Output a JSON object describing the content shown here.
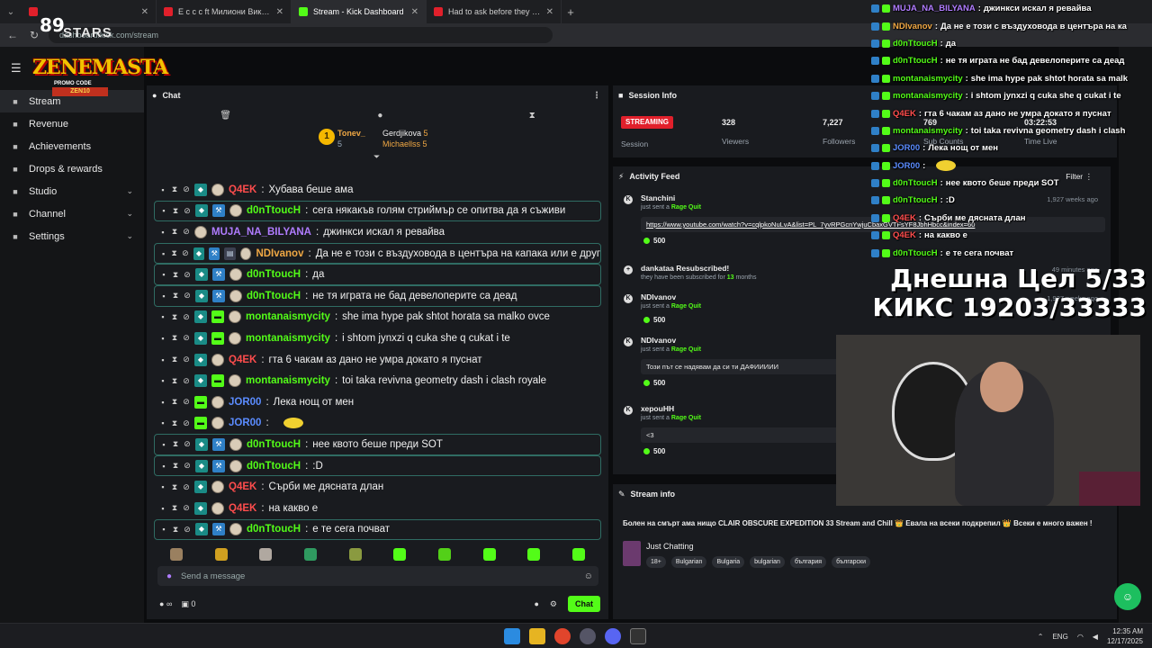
{
  "browser": {
    "tabs": [
      {
        "title": "",
        "color": "#e1202b",
        "active": false
      },
      {
        "title": "Е с с с ft Милиони Викай ги - YouTube",
        "color": "#e1202b",
        "active": false
      },
      {
        "title": "Stream - Kick Dashboard",
        "color": "#53fc18",
        "active": true
      },
      {
        "title": "Had to ask before they started",
        "color": "#e1202b",
        "active": false
      }
    ],
    "url": "dashboard.kick.com/stream"
  },
  "overlay_logo": {
    "stars_number": "89",
    "stars_label": "STARS",
    "brand": "ZENEMASTA",
    "promo": "PROMO CODE",
    "promo_code": "ZEN10"
  },
  "sidebar": {
    "items": [
      {
        "label": "Stream",
        "icon": "broadcast-icon",
        "active": true,
        "chevron": false
      },
      {
        "label": "Revenue",
        "icon": "wallet-icon",
        "active": false,
        "chevron": false
      },
      {
        "label": "Achievements",
        "icon": "trophy-icon",
        "active": false,
        "chevron": false
      },
      {
        "label": "Drops & rewards",
        "icon": "gift-icon",
        "active": false,
        "chevron": false
      },
      {
        "label": "Studio",
        "icon": "studio-icon",
        "active": false,
        "chevron": true
      },
      {
        "label": "Channel",
        "icon": "user-icon",
        "active": false,
        "chevron": true
      },
      {
        "label": "Settings",
        "icon": "gear-icon",
        "active": false,
        "chevron": true
      }
    ]
  },
  "chat": {
    "title": "Chat",
    "pinned": {
      "rank": "1",
      "user1": "Tonev_",
      "user1_count": "5",
      "user2": "Gerdjikova",
      "user2_count": "5",
      "user3": "Michaellss",
      "user3_count": "5"
    },
    "messages": [
      {
        "user": "Q4EK",
        "color": "#ff4d4d",
        "text": "Хубава беше ама",
        "badges": [
          "sub"
        ],
        "hl": false
      },
      {
        "user": "d0nTtoucH",
        "color": "#53fc18",
        "text": "сега някакъв голям стриймър се опитва да я съживи",
        "badges": [
          "sub",
          "vip"
        ],
        "hl": true
      },
      {
        "user": "MUJA_NA_BILYANA",
        "color": "#b07cff",
        "text": "джинкси искал я ревайва",
        "badges": [],
        "hl": false
      },
      {
        "user": "NDIvanov",
        "color": "#f0a844",
        "text": "Да не е този с въздуховода в центъра на капака или е друг",
        "badges": [
          "sub",
          "vip",
          "gift"
        ],
        "hl": true
      },
      {
        "user": "d0nTtoucH",
        "color": "#53fc18",
        "text": "да",
        "badges": [
          "sub",
          "vip"
        ],
        "hl": true
      },
      {
        "user": "d0nTtoucH",
        "color": "#53fc18",
        "text": "не тя играта не бад девелоперите са деад",
        "badges": [
          "sub",
          "vip"
        ],
        "hl": true
      },
      {
        "user": "montanaismycity",
        "color": "#53fc18",
        "text": "she ima hype pak shtot horata sa malko ovce",
        "badges": [
          "sub",
          "og"
        ],
        "hl": false
      },
      {
        "user": "montanaismycity",
        "color": "#53fc18",
        "text": "i shtom jynxzi q cuka she q cukat i te",
        "badges": [
          "sub",
          "og"
        ],
        "hl": false
      },
      {
        "user": "Q4EK",
        "color": "#ff4d4d",
        "text": "гта 6 чакам аз дано не умра докато я пуснат",
        "badges": [
          "sub"
        ],
        "hl": false
      },
      {
        "user": "montanaismycity",
        "color": "#53fc18",
        "text": "toi taka revivna geometry dash i clash royale",
        "badges": [
          "sub",
          "og"
        ],
        "hl": false
      },
      {
        "user": "JOR00",
        "color": "#5b8cff",
        "text": "Лека нощ от мен",
        "badges": [
          "og"
        ],
        "hl": false
      },
      {
        "user": "JOR00",
        "color": "#5b8cff",
        "text": "",
        "badges": [
          "og"
        ],
        "hl": false,
        "sticker": true
      },
      {
        "user": "d0nTtoucH",
        "color": "#53fc18",
        "text": "нее квото беше преди SOT",
        "badges": [
          "sub",
          "vip"
        ],
        "hl": true
      },
      {
        "user": "d0nTtoucH",
        "color": "#53fc18",
        "text": ":D",
        "badges": [
          "sub",
          "vip"
        ],
        "hl": true
      },
      {
        "user": "Q4EK",
        "color": "#ff4d4d",
        "text": "Сърби ме дясната длан",
        "badges": [
          "sub"
        ],
        "hl": false
      },
      {
        "user": "Q4EK",
        "color": "#ff4d4d",
        "text": "на какво е",
        "badges": [
          "sub"
        ],
        "hl": false
      },
      {
        "user": "d0nTtoucH",
        "color": "#53fc18",
        "text": "е те сега почват",
        "badges": [
          "sub",
          "vip"
        ],
        "hl": true
      }
    ],
    "input_placeholder": "Send a message",
    "footer_count": "0",
    "footer_infinity": "∞",
    "chat_button": "Chat"
  },
  "session": {
    "title": "Session Info",
    "badge": "STREAMING",
    "session_label": "Session",
    "viewers": "328",
    "viewers_label": "Viewers",
    "followers": "7,227",
    "followers_label": "Followers",
    "subs": "769",
    "subs_label": "Sub Counts",
    "time": "03:22:53",
    "time_label": "Time Live"
  },
  "feed": {
    "title": "Activity Feed",
    "filter": "Filter",
    "items": [
      {
        "name": "Stanchini",
        "sub": "just sent a",
        "reward": "Rage Quit",
        "ago": "1,927 weeks ago",
        "box": "https://www.youtube.com/watch?v=cqlpkoNuLvA&list=PL_7yvRPGcnYwjuCbaxGVTFsYF8JbhHbcc&index=60",
        "amount": "500"
      },
      {
        "name": "dankataa Resubscribed!",
        "sub": "they have been subscribed for",
        "months": "13",
        "months_suffix": "months",
        "ago": "49 minutes ago"
      },
      {
        "name": "NDIvanov",
        "sub": "just sent a",
        "reward": "Rage Quit",
        "ago": "1,927 weeks ago",
        "amount": "500"
      },
      {
        "name": "NDIvanov",
        "sub": "just sent a",
        "reward": "Rage Quit",
        "ago": "",
        "box": "Този път се надявам да си ти ДАФИИИИИ",
        "amount": "500"
      },
      {
        "name": "хероuНН",
        "sub": "just sent a",
        "reward": "Rage Quit",
        "ago": "",
        "box": "<3",
        "amount": "500"
      }
    ]
  },
  "stream_info": {
    "title": "Stream info",
    "stream_title": "Болен на смърт ама нищо CLAIR OBSCURE EXPEDITION 33 Stream and Chill 👑 Евала на всеки подкрепил 👑 Всеки е много важен !",
    "category": "Just Chatting",
    "tags": [
      "18+",
      "Bulgarian",
      "Bulgaria",
      "bulgarian",
      "българия",
      "български"
    ]
  },
  "overlay_chat": [
    {
      "user": "MUJA_NA_BILYANA",
      "color": "#b07cff",
      "text": "джинкси искал я ревайва"
    },
    {
      "user": "NDIvanov",
      "color": "#f0a844",
      "text": "Да не е този с въздуховода в центъра на ка"
    },
    {
      "user": "d0nTtoucH",
      "color": "#53fc18",
      "text": "да"
    },
    {
      "user": "d0nTtoucH",
      "color": "#53fc18",
      "text": "не тя играта не бад девелоперите са деад"
    },
    {
      "user": "montanaismycity",
      "color": "#53fc18",
      "text": "she ima hype pak shtot horata sa malk"
    },
    {
      "user": "montanaismycity",
      "color": "#53fc18",
      "text": "i shtom jynxzi q cuka she q cukat i te"
    },
    {
      "user": "Q4EK",
      "color": "#ff4d4d",
      "text": "гта 6 чакам аз дано не умра докато я пуснат"
    },
    {
      "user": "montanaismycity",
      "color": "#53fc18",
      "text": "toi taka revivna geometry dash i clash"
    },
    {
      "user": "JOR00",
      "color": "#5b8cff",
      "text": "Лека нощ от мен"
    },
    {
      "user": "JOR00",
      "color": "#5b8cff",
      "text": ""
    },
    {
      "user": "d0nTtoucH",
      "color": "#53fc18",
      "text": "нее квото беше преди SOT"
    },
    {
      "user": "d0nTtoucH",
      "color": "#53fc18",
      "text": ":D"
    },
    {
      "user": "Q4EK",
      "color": "#ff4d4d",
      "text": "Сърби ме дясната длан"
    },
    {
      "user": "Q4EK",
      "color": "#ff4d4d",
      "text": "на какво е"
    },
    {
      "user": "d0nTtoucH",
      "color": "#53fc18",
      "text": "е те сега почват"
    }
  ],
  "goal": {
    "line1": "Днешна Цел 5/33",
    "line2": "КИКС 19203/33333"
  },
  "taskbar": {
    "lang": "ENG",
    "time": "12:35 AM",
    "date": "12/17/2025"
  },
  "colors": {
    "accent": "#53fc18",
    "live": "#e1202b"
  }
}
